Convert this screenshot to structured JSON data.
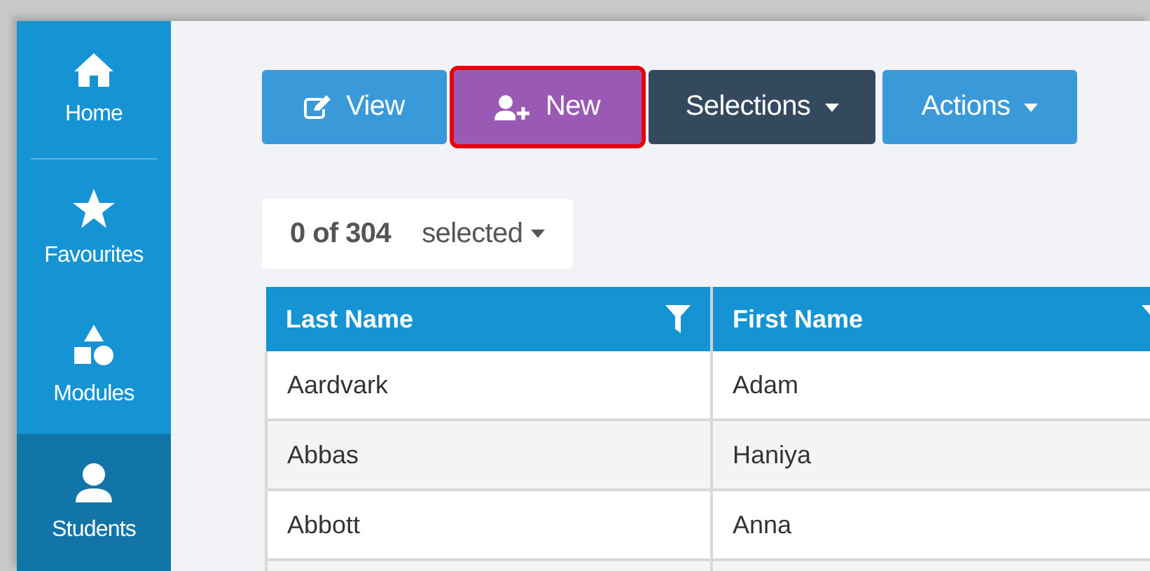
{
  "sidebar": {
    "items": [
      {
        "kind": "home",
        "label": "Home",
        "selected": false
      },
      {
        "kind": "star",
        "label": "Favourites",
        "selected": false
      },
      {
        "kind": "modules",
        "label": "Modules",
        "selected": false
      },
      {
        "kind": "person",
        "label": "Students",
        "selected": true
      }
    ]
  },
  "toolbar": {
    "buttons": [
      {
        "kind": "view",
        "label": "View",
        "highlighted": false
      },
      {
        "kind": "new",
        "label": "New",
        "highlighted": true
      },
      {
        "kind": "selections",
        "label": "Selections",
        "highlighted": false
      },
      {
        "kind": "actions",
        "label": "Actions",
        "highlighted": false
      }
    ]
  },
  "selection": {
    "count": "0 of 304",
    "label": "selected"
  },
  "table": {
    "columns": [
      "Last Name",
      "First Name"
    ],
    "rows": [
      [
        "Aardvark",
        "Adam"
      ],
      [
        "Abbas",
        "Haniya"
      ],
      [
        "Abbott",
        "Anna"
      ]
    ]
  }
}
